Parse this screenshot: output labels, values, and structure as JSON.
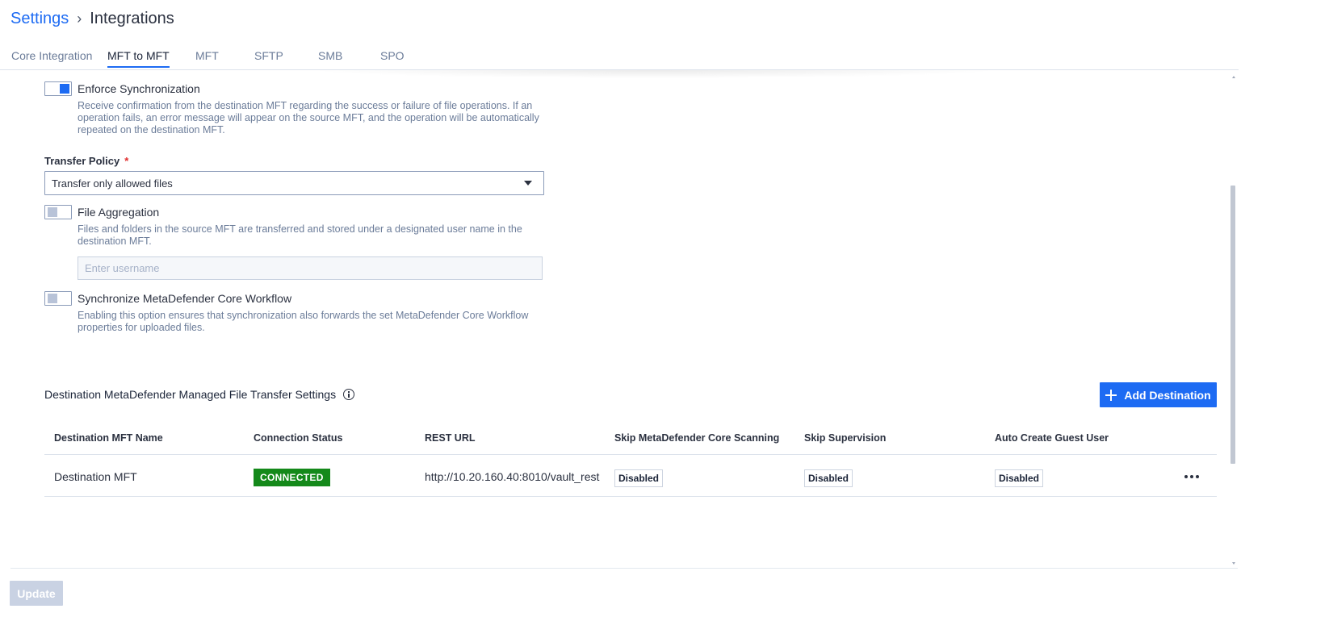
{
  "breadcrumb": {
    "parent": "Settings",
    "current": "Integrations"
  },
  "tabs": [
    {
      "label": "Core Integration",
      "active": false
    },
    {
      "label": "MFT to MFT",
      "active": true
    },
    {
      "label": "MFT",
      "active": false
    },
    {
      "label": "SFTP",
      "active": false
    },
    {
      "label": "SMB",
      "active": false
    },
    {
      "label": "SPO",
      "active": false
    }
  ],
  "options": {
    "enforce_sync": {
      "title": "Enforce Synchronization",
      "description": "Receive confirmation from the destination MFT regarding the success or failure of file operations. If an operation fails, an error message will appear on the source MFT, and the operation will be automatically repeated on the destination MFT.",
      "enabled": true
    },
    "file_aggregation": {
      "title": "File Aggregation",
      "description": "Files and folders in the source MFT are transferred and stored under a designated user name in the destination MFT.",
      "enabled": false,
      "username_placeholder": "Enter username",
      "username_value": ""
    },
    "sync_workflow": {
      "title": "Synchronize MetaDefender Core Workflow",
      "description": "Enabling this option ensures that synchronization also forwards the set MetaDefender Core Workflow properties for uploaded files.",
      "enabled": false
    }
  },
  "transfer_policy": {
    "label": "Transfer Policy",
    "required_marker": "*",
    "value": "Transfer only allowed files"
  },
  "destinations": {
    "title": "Destination MetaDefender Managed File Transfer Settings",
    "add_button_label": "Add Destination",
    "columns": [
      "Destination MFT Name",
      "Connection Status",
      "REST URL",
      "Skip MetaDefender Core Scanning",
      "Skip Supervision",
      "Auto Create Guest User"
    ],
    "rows": [
      {
        "name": "Destination MFT",
        "status": "CONNECTED",
        "rest_url": "http://10.20.160.40:8010/vault_rest",
        "skip_core_scanning": "Disabled",
        "skip_supervision": "Disabled",
        "auto_create_guest": "Disabled"
      }
    ]
  },
  "footer": {
    "update_label": "Update"
  },
  "colors": {
    "accent": "#1d6bf3",
    "connected": "#14891a",
    "required": "#e02b2b"
  }
}
